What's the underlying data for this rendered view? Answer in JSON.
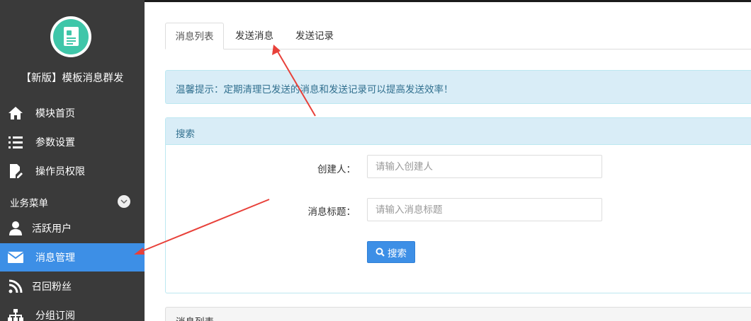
{
  "app": {
    "title": "【新版】模板消息群发"
  },
  "sidebar": {
    "items": [
      {
        "label": "模块首页",
        "icon": "home-icon"
      },
      {
        "label": "参数设置",
        "icon": "list-icon"
      },
      {
        "label": "操作员权限",
        "icon": "document-edit-icon"
      }
    ],
    "section_label": "业务菜单",
    "section_toggle_icon": "chevron-down-icon",
    "business_items": [
      {
        "label": "活跃用户",
        "icon": "user-icon",
        "active": false
      },
      {
        "label": "消息管理",
        "icon": "envelope-icon",
        "active": true
      },
      {
        "label": "召回粉丝",
        "icon": "rss-icon",
        "active": false
      },
      {
        "label": "分组订阅",
        "icon": "sitemap-icon",
        "active": false
      }
    ]
  },
  "tabs": [
    {
      "label": "消息列表",
      "active": true
    },
    {
      "label": "发送消息",
      "active": false
    },
    {
      "label": "发送记录",
      "active": false
    }
  ],
  "alert": {
    "text": "温馨提示：定期清理已发送的消息和发送记录可以提高发送效率！"
  },
  "search_panel": {
    "title": "搜索",
    "creator_label": "创建人：",
    "creator_placeholder": "请输入创建人",
    "creator_value": "",
    "title_label": "消息标题：",
    "title_placeholder": "请输入消息标题",
    "title_value": "",
    "search_button_label": "搜索",
    "search_button_icon": "search-icon"
  },
  "list_panel": {
    "title": "消息列表"
  },
  "colors": {
    "sidebar_bg": "#3a3a3a",
    "active_item": "#3d8fe6",
    "info_bg": "#d9edf7",
    "info_text": "#31708f",
    "logo_accent": "#3fc6a9",
    "annotation_arrow": "#e8413a"
  }
}
